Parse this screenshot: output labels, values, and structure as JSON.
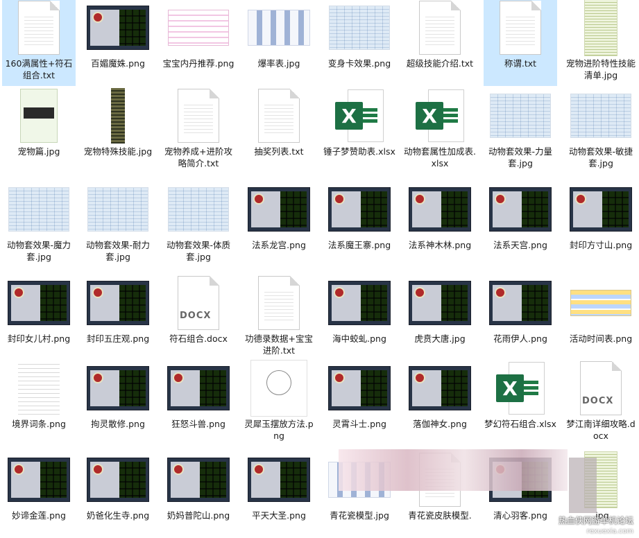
{
  "files": [
    {
      "name": "160满属性+符石组合.txt",
      "type": "txt",
      "selected": true
    },
    {
      "name": "百媚魔姝.png",
      "type": "game"
    },
    {
      "name": "宝宝内丹推荐.png",
      "type": "pink"
    },
    {
      "name": "爆率表.jpg",
      "type": "blue"
    },
    {
      "name": "变身卡效果.png",
      "type": "sheet"
    },
    {
      "name": "超级技能介绍.txt",
      "type": "txt"
    },
    {
      "name": "称谓.txt",
      "type": "txt",
      "selected": true
    },
    {
      "name": "宠物进阶特性技能清单.jpg",
      "type": "tall"
    },
    {
      "name": "宠物篇.jpg",
      "type": "pet"
    },
    {
      "name": "宠物特殊技能.jpg",
      "type": "narrow"
    },
    {
      "name": "宠物养成+进阶攻略简介.txt",
      "type": "txt"
    },
    {
      "name": "抽奖列表.txt",
      "type": "txt"
    },
    {
      "name": "锤子梦赞助表.xlsx",
      "type": "xlsx"
    },
    {
      "name": "动物套属性加成表.xlsx",
      "type": "xlsx"
    },
    {
      "name": "动物套效果-力量套.jpg",
      "type": "sheet"
    },
    {
      "name": "动物套效果-敏捷套.jpg",
      "type": "sheet"
    },
    {
      "name": "动物套效果-魔力套.jpg",
      "type": "sheet"
    },
    {
      "name": "动物套效果-耐力套.jpg",
      "type": "sheet"
    },
    {
      "name": "动物套效果-体质套.jpg",
      "type": "sheet"
    },
    {
      "name": "法系龙宫.png",
      "type": "game"
    },
    {
      "name": "法系魔王寨.png",
      "type": "game"
    },
    {
      "name": "法系神木林.png",
      "type": "game"
    },
    {
      "name": "法系天宫.png",
      "type": "game"
    },
    {
      "name": "封印方寸山.png",
      "type": "game"
    },
    {
      "name": "封印女儿村.png",
      "type": "game"
    },
    {
      "name": "封印五庄观.png",
      "type": "game"
    },
    {
      "name": "符石组合.docx",
      "type": "docx"
    },
    {
      "name": "功德录数据+宝宝进阶.txt",
      "type": "txt"
    },
    {
      "name": "海中蛟虬.png",
      "type": "game"
    },
    {
      "name": "虎贲大唐.jpg",
      "type": "game"
    },
    {
      "name": "花雨伊人.png",
      "type": "game"
    },
    {
      "name": "活动时间表.png",
      "type": "event"
    },
    {
      "name": "境界词条.png",
      "type": "list"
    },
    {
      "name": "拘灵散修.png",
      "type": "game"
    },
    {
      "name": "狂怒斗兽.png",
      "type": "game"
    },
    {
      "name": "灵犀玉摆放方法.png",
      "type": "diagram"
    },
    {
      "name": "灵霄斗士.png",
      "type": "game"
    },
    {
      "name": "落伽神女.png",
      "type": "game"
    },
    {
      "name": "梦幻符石组合.xlsx",
      "type": "xlsx"
    },
    {
      "name": "梦江南详细攻略.docx",
      "type": "docx"
    },
    {
      "name": "妙谛金莲.png",
      "type": "game"
    },
    {
      "name": "奶爸化生寺.png",
      "type": "game"
    },
    {
      "name": "奶妈普陀山.png",
      "type": "game"
    },
    {
      "name": "平天大圣.png",
      "type": "game"
    },
    {
      "name": "青花瓷模型.jpg",
      "type": "blue"
    },
    {
      "name": "青花瓷皮肤模型.",
      "type": "txt"
    },
    {
      "name": "清心羽客.png",
      "type": "game"
    },
    {
      "name": ".jpg",
      "type": "tall"
    }
  ],
  "watermark": {
    "line1": "热血侠网游单机论坛",
    "line2": "rexuexia.com"
  }
}
